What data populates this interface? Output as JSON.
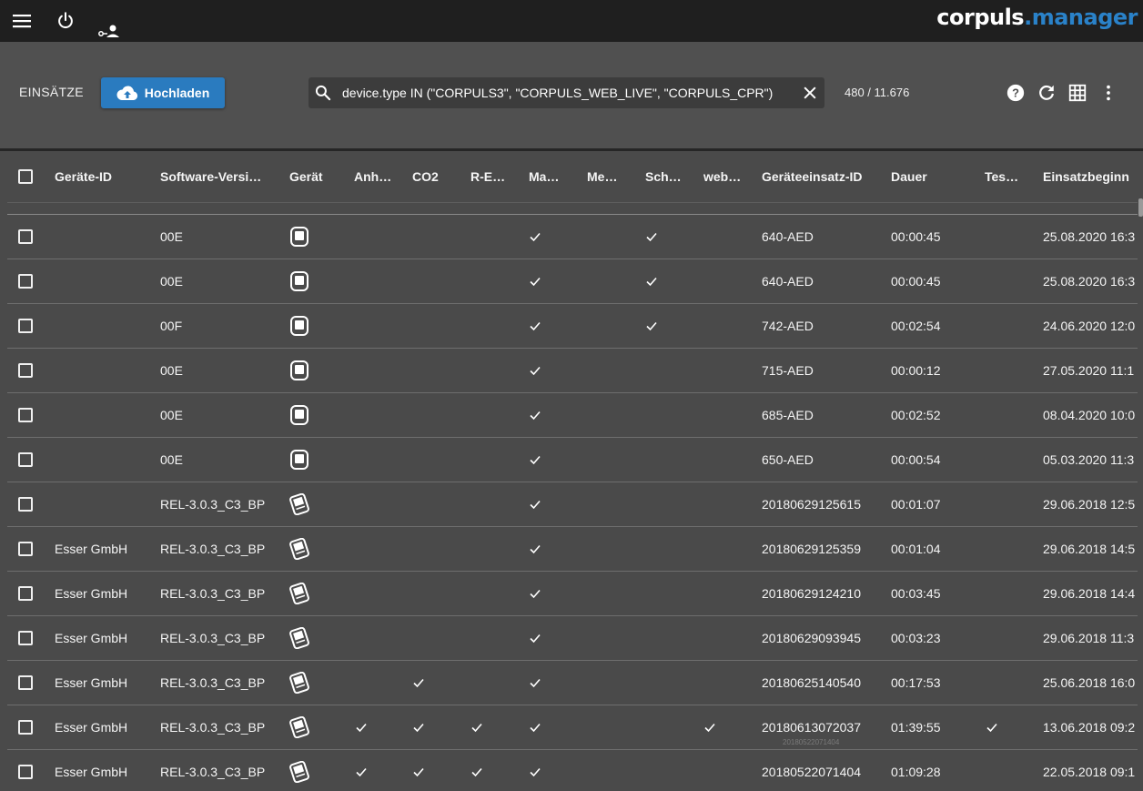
{
  "logo": {
    "part1": "corpuls",
    "part2": ".manager"
  },
  "toolbar": {
    "section_title": "EINSÄTZE",
    "upload_label": "Hochladen",
    "search_value": "device.type IN (\"CORPULS3\", \"CORPULS_WEB_LIVE\", \"CORPULS_CPR\")",
    "count": "480 / 11.676"
  },
  "columns": [
    "Geräte-ID",
    "Software-Versi…",
    "Gerät",
    "Anh…",
    "CO2",
    "R-E…",
    "Ma…",
    "Me…",
    "Sch…",
    "web…",
    "Geräteeinsatz-ID",
    "Dauer",
    "Tes…",
    "Einsatzbeginn"
  ],
  "rows": [
    {
      "geraete_id": "",
      "software": "00E",
      "device": "aed",
      "einsatz_id": "640-AED",
      "dauer": "00:00:45",
      "beginn": "25.08.2020 16:3",
      "checks": [
        "ma",
        "sch"
      ]
    },
    {
      "geraete_id": "",
      "software": "00E",
      "device": "aed",
      "einsatz_id": "640-AED",
      "dauer": "00:00:45",
      "beginn": "25.08.2020 16:3",
      "checks": [
        "ma",
        "sch"
      ]
    },
    {
      "geraete_id": "",
      "software": "00F",
      "device": "aed",
      "einsatz_id": "742-AED",
      "dauer": "00:02:54",
      "beginn": "24.06.2020 12:0",
      "checks": [
        "ma",
        "sch"
      ]
    },
    {
      "geraete_id": "",
      "software": "00E",
      "device": "aed",
      "einsatz_id": "715-AED",
      "dauer": "00:00:12",
      "beginn": "27.05.2020 11:1",
      "checks": [
        "ma"
      ]
    },
    {
      "geraete_id": "",
      "software": "00E",
      "device": "aed",
      "einsatz_id": "685-AED",
      "dauer": "00:02:52",
      "beginn": "08.04.2020 10:0",
      "checks": [
        "ma"
      ]
    },
    {
      "geraete_id": "",
      "software": "00E",
      "device": "aed",
      "einsatz_id": "650-AED",
      "dauer": "00:00:54",
      "beginn": "05.03.2020 11:3",
      "checks": [
        "ma"
      ]
    },
    {
      "geraete_id": "",
      "software": "REL-3.0.3_C3_BP",
      "device": "c3",
      "einsatz_id": "20180629125615",
      "dauer": "00:01:07",
      "beginn": "29.06.2018 12:5",
      "checks": [
        "ma"
      ]
    },
    {
      "geraete_id": "Esser GmbH",
      "software": "REL-3.0.3_C3_BP",
      "device": "c3",
      "einsatz_id": "20180629125359",
      "dauer": "00:01:04",
      "beginn": "29.06.2018 14:5",
      "checks": [
        "ma"
      ]
    },
    {
      "geraete_id": "Esser GmbH",
      "software": "REL-3.0.3_C3_BP",
      "device": "c3",
      "einsatz_id": "20180629124210",
      "dauer": "00:03:45",
      "beginn": "29.06.2018 14:4",
      "checks": [
        "ma"
      ]
    },
    {
      "geraete_id": "Esser GmbH",
      "software": "REL-3.0.3_C3_BP",
      "device": "c3",
      "einsatz_id": "20180629093945",
      "dauer": "00:03:23",
      "beginn": "29.06.2018 11:3",
      "checks": [
        "ma"
      ]
    },
    {
      "geraete_id": "Esser GmbH",
      "software": "REL-3.0.3_C3_BP",
      "device": "c3",
      "einsatz_id": "20180625140540",
      "dauer": "00:17:53",
      "beginn": "25.06.2018 16:0",
      "checks": [
        "co2",
        "ma"
      ]
    },
    {
      "geraete_id": "Esser GmbH",
      "software": "REL-3.0.3_C3_BP",
      "device": "c3",
      "einsatz_id": "20180613072037",
      "dauer": "01:39:55",
      "beginn": "13.06.2018 09:2",
      "checks": [
        "anh",
        "co2",
        "re",
        "ma",
        "web",
        "tes"
      ]
    },
    {
      "geraete_id": "Esser GmbH",
      "software": "REL-3.0.3_C3_BP",
      "device": "c3",
      "einsatz_id": "20180522071404",
      "dauer": "01:09:28",
      "beginn": "22.05.2018 09:1",
      "checks": [
        "anh",
        "co2",
        "re",
        "ma"
      ]
    }
  ],
  "tooltip": "20180522071404"
}
